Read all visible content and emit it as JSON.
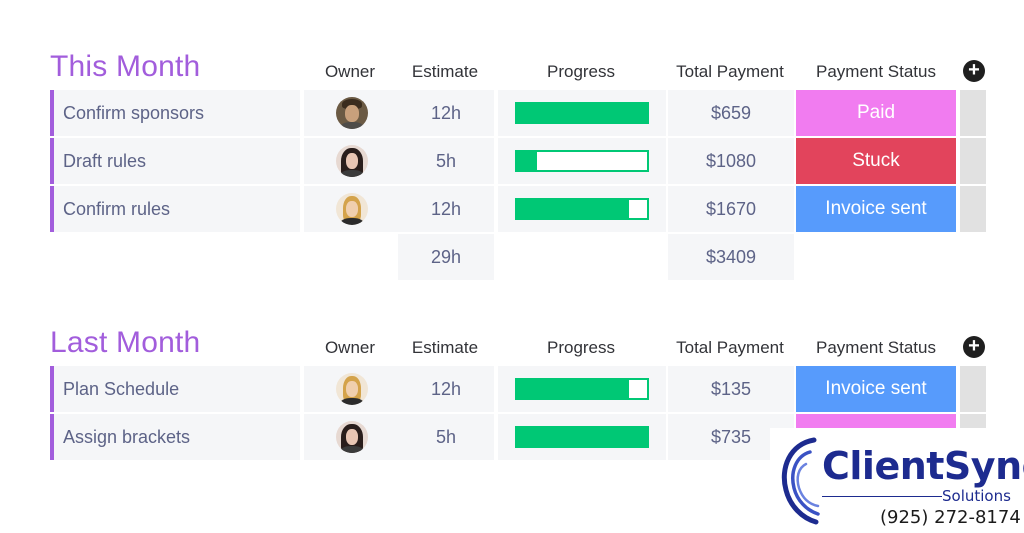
{
  "groups": [
    {
      "title": "This Month",
      "columns": {
        "owner": "Owner",
        "estimate": "Estimate",
        "progress": "Progress",
        "payment": "Total Payment",
        "status": "Payment Status"
      },
      "rows": [
        {
          "name": "Confirm sponsors",
          "avatar": "avatar-man-brown-hair",
          "estimate": "12h",
          "progress": 1.0,
          "payment": "$659",
          "status": "Paid",
          "status_color": "#f17cf0"
        },
        {
          "name": "Draft rules",
          "avatar": "avatar-woman-dark-hair",
          "estimate": "5h",
          "progress": 0.15,
          "payment": "$1080",
          "status": "Stuck",
          "status_color": "#e2445c"
        },
        {
          "name": "Confirm rules",
          "avatar": "avatar-woman-blonde-hair",
          "estimate": "12h",
          "progress": 0.86,
          "payment": "$1670",
          "status": "Invoice sent",
          "status_color": "#579bfc"
        }
      ],
      "summary": {
        "estimate": "29h",
        "payment": "$3409"
      }
    },
    {
      "title": "Last Month",
      "columns": {
        "owner": "Owner",
        "estimate": "Estimate",
        "progress": "Progress",
        "payment": "Total Payment",
        "status": "Payment Status"
      },
      "rows": [
        {
          "name": "Plan Schedule",
          "avatar": "avatar-woman-blonde-hair",
          "estimate": "12h",
          "progress": 0.86,
          "payment": "$135",
          "status": "Invoice sent",
          "status_color": "#579bfc"
        },
        {
          "name": "Assign brackets",
          "avatar": "avatar-woman-dark-hair",
          "estimate": "5h",
          "progress": 1.0,
          "payment": "$735",
          "status": "",
          "status_color": "#f17cf0"
        }
      ]
    }
  ],
  "colors": {
    "group_accent": "#a25ddc",
    "progress": "#00c875",
    "cell_bg": "#f5f6f8"
  },
  "icons": {
    "add": "plus-circle-icon"
  },
  "logo": {
    "name": "ClientSync",
    "sub": "Solutions",
    "phone": "(925) 272-8174",
    "color": "#1d2b8f"
  }
}
